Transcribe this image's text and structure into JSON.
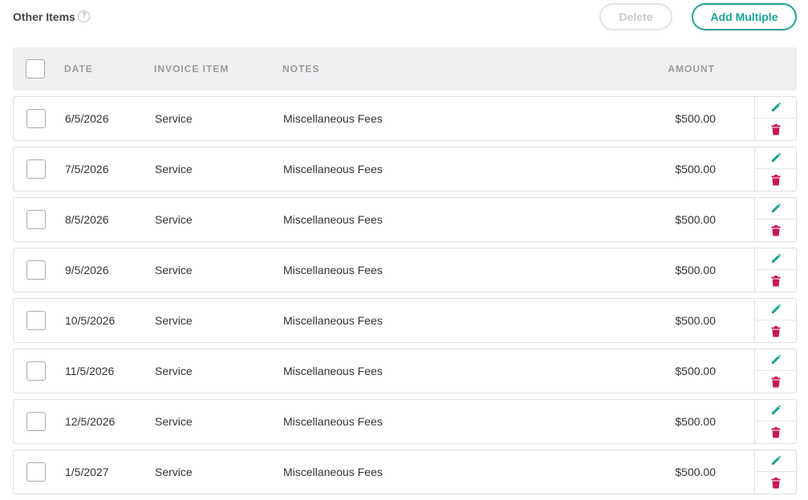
{
  "section": {
    "title": "Other Items",
    "help_icon": "question-circle-icon"
  },
  "toolbar": {
    "delete_label": "Delete",
    "add_multiple_label": "Add Multiple"
  },
  "colors": {
    "accent": "#1aa594",
    "danger": "#c8174f",
    "header_bg": "#eff0f2"
  },
  "table": {
    "columns": {
      "date": "DATE",
      "invoice_item": "INVOICE ITEM",
      "notes": "NOTES",
      "amount": "AMOUNT"
    },
    "rows": [
      {
        "date": "6/5/2026",
        "item": "Service",
        "notes": "Miscellaneous Fees",
        "amount": "$500.00"
      },
      {
        "date": "7/5/2026",
        "item": "Service",
        "notes": "Miscellaneous Fees",
        "amount": "$500.00"
      },
      {
        "date": "8/5/2026",
        "item": "Service",
        "notes": "Miscellaneous Fees",
        "amount": "$500.00"
      },
      {
        "date": "9/5/2026",
        "item": "Service",
        "notes": "Miscellaneous Fees",
        "amount": "$500.00"
      },
      {
        "date": "10/5/2026",
        "item": "Service",
        "notes": "Miscellaneous Fees",
        "amount": "$500.00"
      },
      {
        "date": "11/5/2026",
        "item": "Service",
        "notes": "Miscellaneous Fees",
        "amount": "$500.00"
      },
      {
        "date": "12/5/2026",
        "item": "Service",
        "notes": "Miscellaneous Fees",
        "amount": "$500.00"
      },
      {
        "date": "1/5/2027",
        "item": "Service",
        "notes": "Miscellaneous Fees",
        "amount": "$500.00"
      }
    ],
    "row_actions": {
      "edit_icon": "pencil-icon",
      "delete_icon": "trash-icon"
    }
  }
}
